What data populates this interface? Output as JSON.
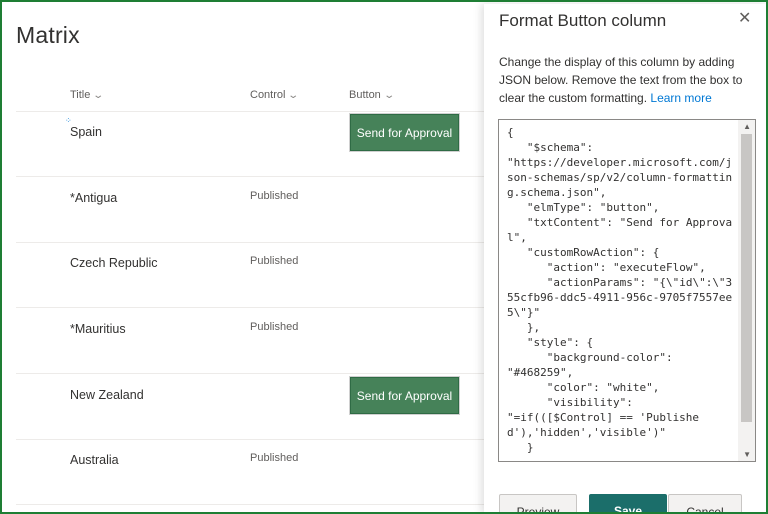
{
  "list": {
    "title": "Matrix",
    "columns": [
      {
        "label": "Title",
        "chevron": "chevron-down-icon"
      },
      {
        "label": "Control",
        "chevron": "chevron-down-icon"
      },
      {
        "label": "Button",
        "chevron": "chevron-down-icon"
      }
    ],
    "rows": [
      {
        "title": "Spain",
        "control": "",
        "button": "Send for Approval"
      },
      {
        "title": "*Antigua",
        "control": "Published",
        "button": ""
      },
      {
        "title": "Czech Republic",
        "control": "Published",
        "button": ""
      },
      {
        "title": "*Mauritius",
        "control": "Published",
        "button": ""
      },
      {
        "title": "New Zealand",
        "control": "",
        "button": "Send for Approval"
      },
      {
        "title": "Australia",
        "control": "Published",
        "button": ""
      }
    ]
  },
  "panel": {
    "title": "Format Button column",
    "close_icon": "close-icon",
    "description": "Change the display of this column by adding JSON below. Remove the text from the box to clear the custom formatting.",
    "learn_more": "Learn more",
    "json_text": "{\n   \"$schema\":\n\"https://developer.microsoft.com/json-schemas/sp/v2/column-formatting.schema.json\",\n   \"elmType\": \"button\",\n   \"txtContent\": \"Send for Approval\",\n   \"customRowAction\": {\n      \"action\": \"executeFlow\",\n      \"actionParams\": \"{\\\"id\\\":\\\"355cfb96-ddc5-4911-956c-9705f7557ee5\\\"}\"\n   },\n   \"style\": {\n      \"background-color\":\n\"#468259\",\n      \"color\": \"white\",\n      \"visibility\":\n\"=if(([$Control] == 'Published'),'hidden','visible')\"\n   }",
    "buttons": {
      "preview": "Preview",
      "save": "Save",
      "cancel": "Cancel"
    }
  },
  "colors": {
    "button_green": "#468259",
    "save_teal": "#1b6e6a",
    "frame_border": "#1e7e34",
    "link_blue": "#0078d4"
  }
}
